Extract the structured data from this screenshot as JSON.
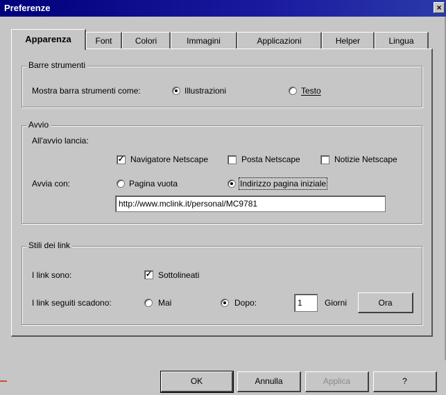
{
  "window": {
    "title": "Preferenze",
    "close_glyph": "×"
  },
  "tabs": [
    {
      "label": "Apparenza",
      "active": true
    },
    {
      "label": "Font"
    },
    {
      "label": "Colori"
    },
    {
      "label": "Immagini"
    },
    {
      "label": "Applicazioni"
    },
    {
      "label": "Helper"
    },
    {
      "label": "Lingua"
    }
  ],
  "toolbars": {
    "group_label": "Barre strumenti",
    "show_label": "Mostra barra strumenti come:",
    "option_pictures": "Illustrazioni",
    "option_text": "Testo",
    "selected": "Illustrazioni"
  },
  "startup": {
    "group_label": "Avvio",
    "launch_label": "All'avvio lancia:",
    "launch_navigator": "Navigatore Netscape",
    "launch_mail": "Posta Netscape",
    "launch_news": "Notizie Netscape",
    "launch_navigator_checked": true,
    "launch_mail_checked": false,
    "launch_news_checked": false,
    "start_with_label": "Avvia con:",
    "option_blank": "Pagina vuota",
    "option_home": "Indirizzo pagina iniziale",
    "selected": "Indirizzo pagina iniziale",
    "home_url": "http://www.mclink.it/personal/MC9781"
  },
  "links": {
    "group_label": "Stili dei link",
    "links_are_label": "I link sono:",
    "underlined": "Sottolineati",
    "underlined_checked": true,
    "expire_label": "I link seguiti scadono:",
    "option_never": "Mai",
    "option_after": "Dopo:",
    "selected": "Dopo:",
    "days_value": "1",
    "days_label": "Giorni",
    "now_button": "Ora"
  },
  "buttons": {
    "ok": "OK",
    "cancel": "Annulla",
    "apply": "Applica",
    "help": "?"
  },
  "check_glyph": "✓",
  "colors": {
    "titlebar": "#00007b",
    "face": "#c6c6c6",
    "disabled_text": "#8a8a8a"
  }
}
